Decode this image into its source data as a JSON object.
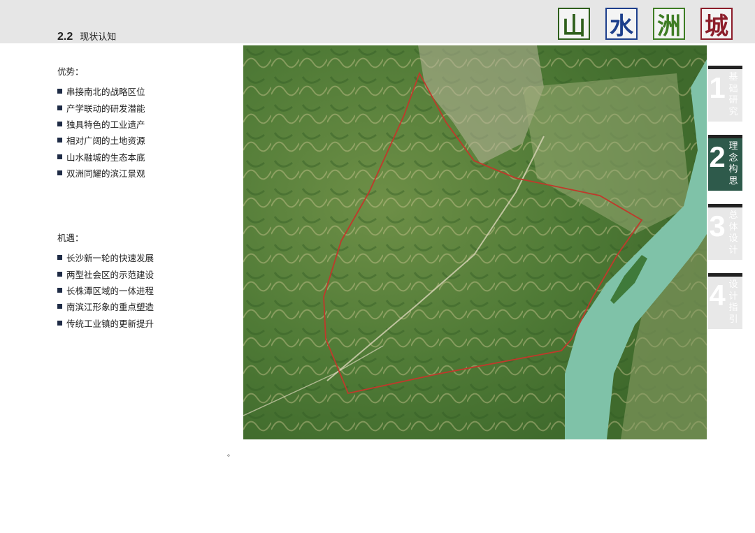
{
  "header": {
    "section_number": "2.2",
    "section_title": "现状认知",
    "brand_chars": [
      {
        "char": "山",
        "color": "#2f5f1c"
      },
      {
        "char": "水",
        "color": "#1d3f8c"
      },
      {
        "char": "洲",
        "color": "#3e7d24"
      },
      {
        "char": "城",
        "color": "#8c1d2a"
      }
    ]
  },
  "advantages": {
    "heading": "优势：",
    "items": [
      "串接南北的战略区位",
      "产学联动的研发潜能",
      "独具特色的工业遗产",
      "相对广阔的土地资源",
      "山水融城的生态本底",
      "双洲同耀的滨江景观"
    ]
  },
  "opportunities": {
    "heading": "机遇：",
    "items": [
      "长沙新一轮的快速发展",
      "两型社会区的示范建设",
      "长株潭区域的一体进程",
      "南滨江形象的重点塑造",
      "传统工业镇的更新提升"
    ]
  },
  "side_tabs": [
    {
      "number": "1",
      "chars": [
        "基",
        "础",
        "研",
        "究"
      ],
      "active": false
    },
    {
      "number": "2",
      "chars": [
        "理",
        "念",
        "构",
        "思"
      ],
      "active": true
    },
    {
      "number": "3",
      "chars": [
        "总",
        "体",
        "设",
        "计"
      ],
      "active": false
    },
    {
      "number": "4",
      "chars": [
        "设",
        "计",
        "指",
        "引"
      ],
      "active": false
    }
  ],
  "map": {
    "description_icon": "satellite-map-image",
    "boundary_color": "#c0392b",
    "river_color": "#7fc2a8"
  },
  "footnote": "。"
}
